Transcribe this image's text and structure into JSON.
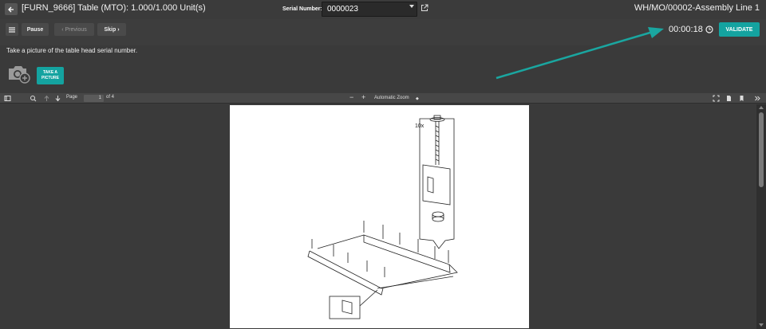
{
  "header": {
    "title": "[FURN_9666] Table (MTO): 1.000/1.000 Unit(s)",
    "serial_label": "Serial Number:",
    "serial_value": "0000023",
    "workorder": "WH/MO/00002-Assembly Line 1"
  },
  "controls": {
    "pause_label": "Pause",
    "previous_label": "‹ Previous",
    "skip_label": "Skip ›",
    "timer": "00:00:18",
    "validate_label": "VALIDATE"
  },
  "instruction": {
    "text": "Take a picture of the table head serial number.",
    "take_picture_label": "TAKE A PICTURE"
  },
  "pdf_toolbar": {
    "page_label": "Page",
    "page_value": "1",
    "of_label": "of 4",
    "zoom_minus": "−",
    "zoom_plus": "+",
    "zoom_value": "Automatic Zoom"
  },
  "pdf_page": {
    "callout_count": "10x"
  },
  "icons": {
    "back": "back-arrow-icon",
    "menu": "hamburger-menu-icon",
    "external": "external-link-icon",
    "clock": "clock-icon",
    "camera": "camera-add-icon",
    "sidebar": "sidebar-toggle-icon",
    "search": "search-icon",
    "prev_page": "arrow-up-icon",
    "next_page": "arrow-down-icon",
    "fullscreen": "fullscreen-icon",
    "open_file": "open-file-icon",
    "bookmark": "bookmark-icon",
    "more_tools": "double-chevron-icon"
  },
  "colors": {
    "accent": "#14a3a0",
    "background": "#3a3a3a"
  }
}
